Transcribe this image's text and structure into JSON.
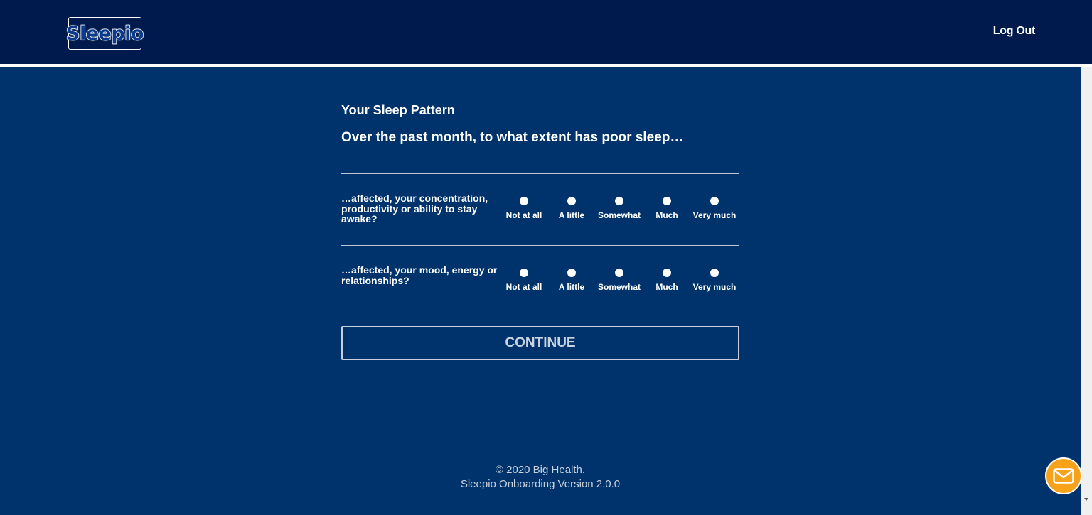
{
  "header": {
    "logo_text": "Sleepio",
    "logout_label": "Log Out"
  },
  "main": {
    "section_title": "Your Sleep Pattern",
    "question_title": "Over the past month, to what extent has poor sleep…",
    "options": [
      "Not at all",
      "A little",
      "Somewhat",
      "Much",
      "Very much"
    ],
    "rows": [
      {
        "label": "…affected, your concentration, productivity or ability to stay awake?"
      },
      {
        "label": "…affected, your mood, energy or relationships?"
      }
    ],
    "continue_label": "CONTINUE"
  },
  "footer": {
    "copyright": "© 2020 Big Health.",
    "version": "Sleepio Onboarding Version 2.0.0"
  },
  "colors": {
    "page_background": "#00336b",
    "header_background": "#001a4d",
    "chat_button": "#f7a21b"
  },
  "icons": {
    "chat": "mail-envelope-icon"
  }
}
